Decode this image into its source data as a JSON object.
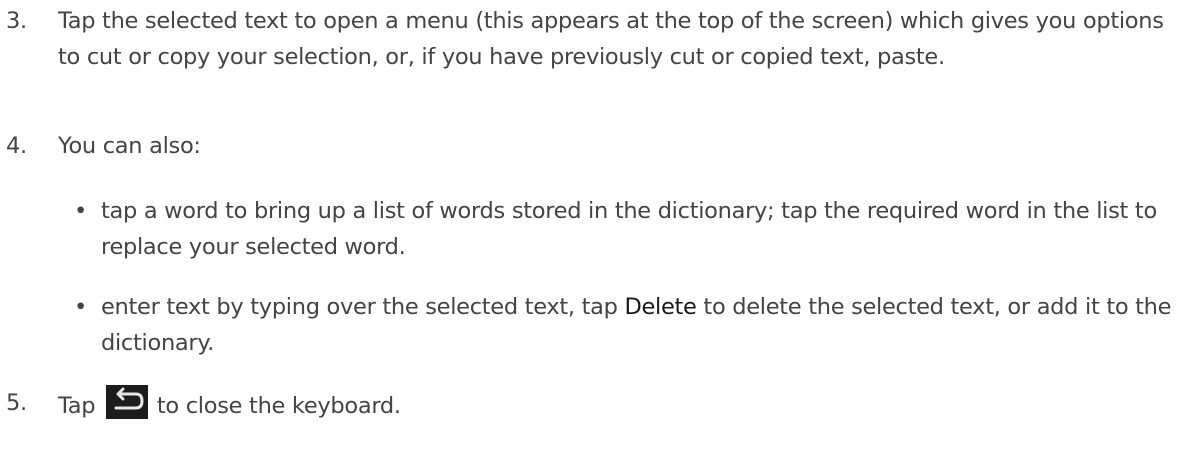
{
  "steps": [
    {
      "number": "3.",
      "text": "Tap the selected text to open a menu (this appears at the top of the screen) which gives you options to cut or copy your selection, or, if you have previously cut or copied text, paste."
    },
    {
      "number": "4.",
      "text": "You can also:",
      "bullets": [
        {
          "text": "tap a word to bring up a list of words stored in the dictionary; tap the required word in the list to replace your selected word."
        },
        {
          "before": "enter text by typing over the selected text, tap ",
          "strong": "Delete",
          "after": " to delete the selected text, or add it to the dictionary."
        }
      ]
    },
    {
      "number": "5.",
      "before": "Tap ",
      "icon": "back-arrow-icon",
      "after": " to close the keyboard."
    }
  ],
  "bullet_glyph": "•"
}
